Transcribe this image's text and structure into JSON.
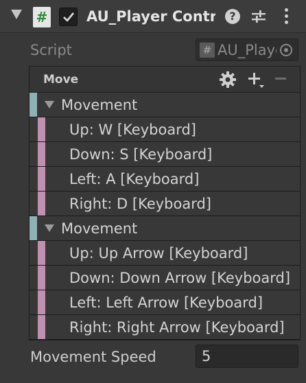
{
  "header": {
    "title": "AU_Player Controller",
    "script_glyph": "#",
    "help_glyph": "?",
    "enabled": true
  },
  "script_row": {
    "label": "Script",
    "value": "AU_PlayerController",
    "glyph": "#"
  },
  "bindings": {
    "title": "Move",
    "colors": {
      "group": "#8fb1b5",
      "part": "#c090b0"
    },
    "rows": [
      {
        "kind": "group",
        "text": "Movement"
      },
      {
        "kind": "part",
        "text": "Up: W [Keyboard]"
      },
      {
        "kind": "part",
        "text": "Down: S [Keyboard]"
      },
      {
        "kind": "part",
        "text": "Left: A [Keyboard]"
      },
      {
        "kind": "part",
        "text": "Right: D [Keyboard]"
      },
      {
        "kind": "group",
        "text": "Movement"
      },
      {
        "kind": "part",
        "text": "Up: Up Arrow [Keyboard]"
      },
      {
        "kind": "part",
        "text": "Down: Down Arrow [Keyboard]"
      },
      {
        "kind": "part",
        "text": "Left: Left Arrow [Keyboard]"
      },
      {
        "kind": "part",
        "text": "Right: Right Arrow [Keyboard]"
      }
    ]
  },
  "movement_speed": {
    "label": "Movement Speed",
    "value": "5"
  },
  "icons": [
    "foldout-arrow-icon",
    "script-icon",
    "checkmark-icon",
    "help-icon",
    "sliders-icon",
    "kebab-icon",
    "target-icon",
    "gear-icon",
    "plus-icon",
    "minus-icon",
    "expand-triangle-icon"
  ]
}
